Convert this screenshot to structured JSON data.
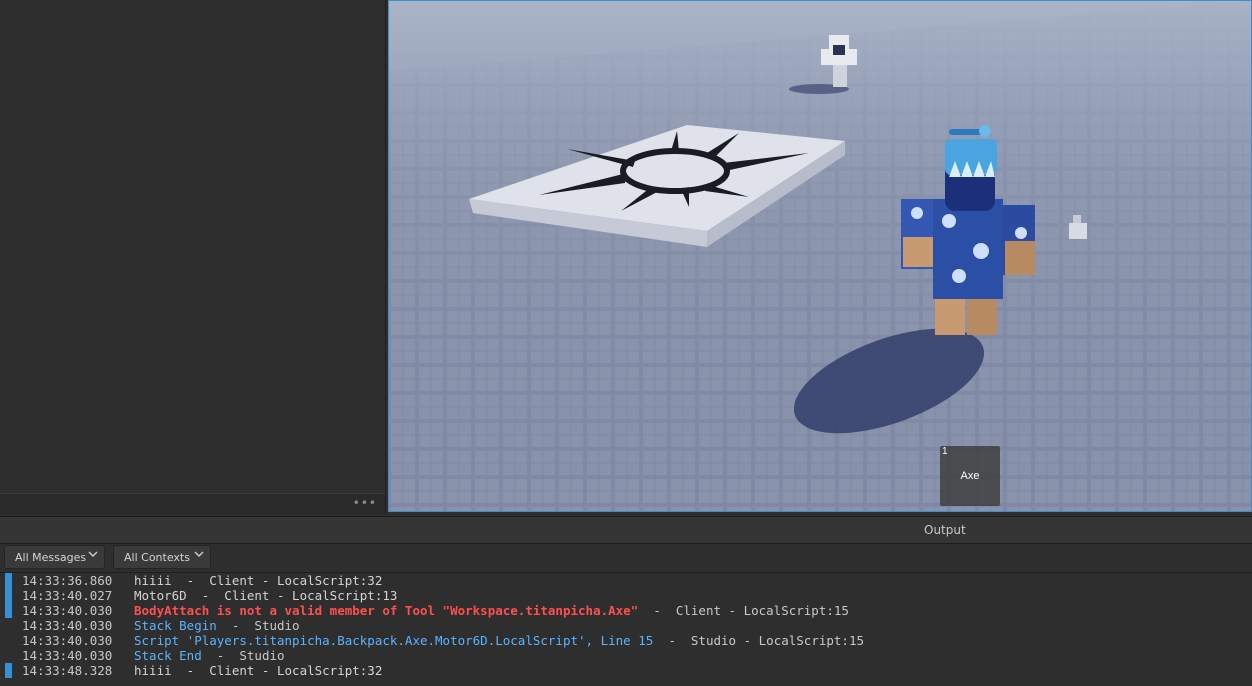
{
  "viewport": {
    "hotbar": {
      "slot_number": "1",
      "tool_name": "Axe"
    }
  },
  "output": {
    "title": "Output",
    "filters": {
      "messages": "All Messages",
      "contexts": "All Contexts"
    },
    "entries": [
      {
        "time": "14:33:36.860",
        "text": "hiiii  -  Client - LocalScript:32",
        "kind": "print",
        "marker": true
      },
      {
        "time": "14:33:40.027",
        "text": "Motor6D  -  Client - LocalScript:13",
        "kind": "print",
        "marker": true
      },
      {
        "time": "14:33:40.030",
        "text": "BodyAttach is not a valid member of Tool \"Workspace.titanpicha.Axe\"",
        "source": "  -  Client - LocalScript:15",
        "kind": "error",
        "marker": true
      },
      {
        "time": "14:33:40.030",
        "text": "Stack Begin",
        "source": "  -  Studio",
        "kind": "info",
        "marker": false
      },
      {
        "time": "14:33:40.030",
        "text": "Script 'Players.titanpicha.Backpack.Axe.Motor6D.LocalScript', Line 15",
        "source": "  -  Studio - LocalScript:15",
        "kind": "info",
        "marker": false
      },
      {
        "time": "14:33:40.030",
        "text": "Stack End",
        "source": "  -  Studio",
        "kind": "info",
        "marker": false
      },
      {
        "time": "14:33:48.328",
        "text": "hiiii  -  Client - LocalScript:32",
        "kind": "print",
        "marker": true
      }
    ]
  },
  "colors": {
    "accent": "#3591d3",
    "error": "#ff4f4f",
    "info": "#5cb3ff",
    "print": "#d4d4d4",
    "source": "#c8c8c8"
  }
}
